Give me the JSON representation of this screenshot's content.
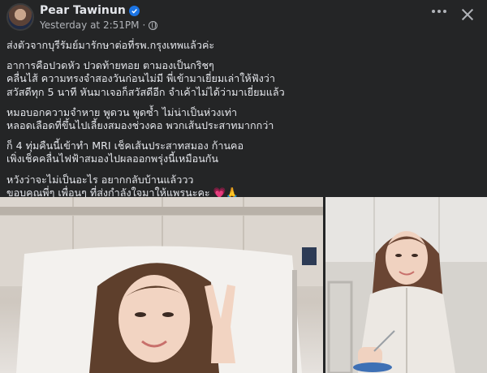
{
  "post": {
    "author": "Pear Tawinun",
    "timestamp": "Yesterday at 2:51PM",
    "privacy_icon": "globe-icon",
    "verified_icon": "verified-badge-icon",
    "paragraphs": [
      [
        "ส่งตัวจากบุรีรัมย์มารักษาต่อที่รพ.กรุงเทพแล้วค่ะ"
      ],
      [
        "อาการคือปวดหัว ปวดท้ายทอย ตามองเป็นกริชๆ",
        "คลื่นไส้ ความทรงจำสองวันก่อนไม่มี พี่เข้ามาเยี่ยมเล่าให้ฟังว่า",
        "สวัสดีทุก 5 นาที หันมาเจอก็สวัสดีอีก จำเค้าไม่ได้ว่ามาเยี่ยมแล้ว"
      ],
      [
        "หมอบอกความจำหาย พูดวน พูดซ้ำ ไม่น่าเป็นห่วงเท่า",
        "หลอดเลือดที่ขึ้นไปเลี้ยงสมองช่วงคอ พวกเส้นประสาทมากกว่า"
      ],
      [
        "ก็ 4 ทุ่มคืนนี้เข้าทำ MRI เช็คเส้นประสาทสมอง ก้านคอ",
        "เพิ่งเช็คคลื่นไฟฟ้าสมองไปผลออกพรุ่งนี้เหมือนกัน"
      ],
      [
        "หวังว่าจะไม่เป็นอะไร อยากกลับบ้านแล้ววว",
        "ขอบคุณพี่ๆ เพื่อนๆ ที่ส่งกำลังใจมาให้แพรนะคะ"
      ]
    ],
    "emoji_end": "💗🙏",
    "colors": {
      "background": "#242526",
      "text": "#e4e6eb",
      "secondary_text": "#b0b3b8",
      "verified": "#1b74e4"
    }
  },
  "photos": [
    {
      "name": "photo-hospital-bed-peace-sign"
    },
    {
      "name": "photo-hospital-gown-eating"
    }
  ]
}
